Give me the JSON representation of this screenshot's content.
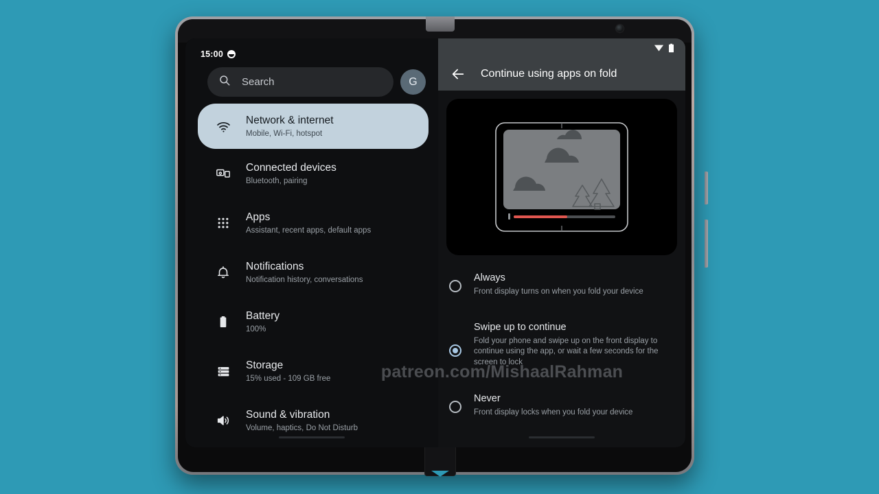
{
  "theme": {
    "background_color": "#2e9ab5",
    "screen_background": "#000000",
    "left_pane_bg": "#0e0f11",
    "right_pane_bg": "#111214",
    "appbar_bg": "#3c4043",
    "selected_row_bg": "#c2d2dd",
    "accent_radio": "#a8c8e4",
    "progress_bar_color": "#e0564f"
  },
  "status_bar": {
    "clock": "15:00",
    "clock_badge_icon": "alarm-dot-icon",
    "wifi_icon": "wifi-icon",
    "battery_icon": "battery-icon"
  },
  "search": {
    "placeholder": "Search",
    "search_icon": "search-icon",
    "avatar_label": "G"
  },
  "settings_list": [
    {
      "title": "Network & internet",
      "subtitle": "Mobile, Wi-Fi, hotspot",
      "icon": "wifi-icon",
      "selected": true
    },
    {
      "title": "Connected devices",
      "subtitle": "Bluetooth, pairing",
      "icon": "connected-devices-icon",
      "selected": false
    },
    {
      "title": "Apps",
      "subtitle": "Assistant, recent apps, default apps",
      "icon": "apps-grid-icon",
      "selected": false
    },
    {
      "title": "Notifications",
      "subtitle": "Notification history, conversations",
      "icon": "bell-icon",
      "selected": false
    },
    {
      "title": "Battery",
      "subtitle": "100%",
      "icon": "battery-icon",
      "selected": false
    },
    {
      "title": "Storage",
      "subtitle": "15% used - 109 GB free",
      "icon": "storage-icon",
      "selected": false
    },
    {
      "title": "Sound & vibration",
      "subtitle": "Volume, haptics, Do Not Disturb",
      "icon": "volume-icon",
      "selected": false
    }
  ],
  "detail": {
    "back_icon": "back-arrow-icon",
    "title": "Continue using apps on fold",
    "illustration": {
      "name": "foldable-video-playback-illustration",
      "scene_icons": [
        "cloud-icon",
        "cloud-icon",
        "cloud-icon",
        "tree-icon",
        "tree-icon"
      ],
      "progress_percent": 52
    },
    "options": [
      {
        "title": "Always",
        "subtitle": "Front display turns on when you fold your device",
        "selected": false
      },
      {
        "title": "Swipe up to continue",
        "subtitle": "Fold your phone and swipe up on the front display to continue using the app, or wait a few seconds for the screen to lock",
        "selected": true
      },
      {
        "title": "Never",
        "subtitle": "Front display locks when you fold your device",
        "selected": false
      }
    ]
  },
  "watermark": {
    "text": "patreon.com/MishaalRahman"
  }
}
